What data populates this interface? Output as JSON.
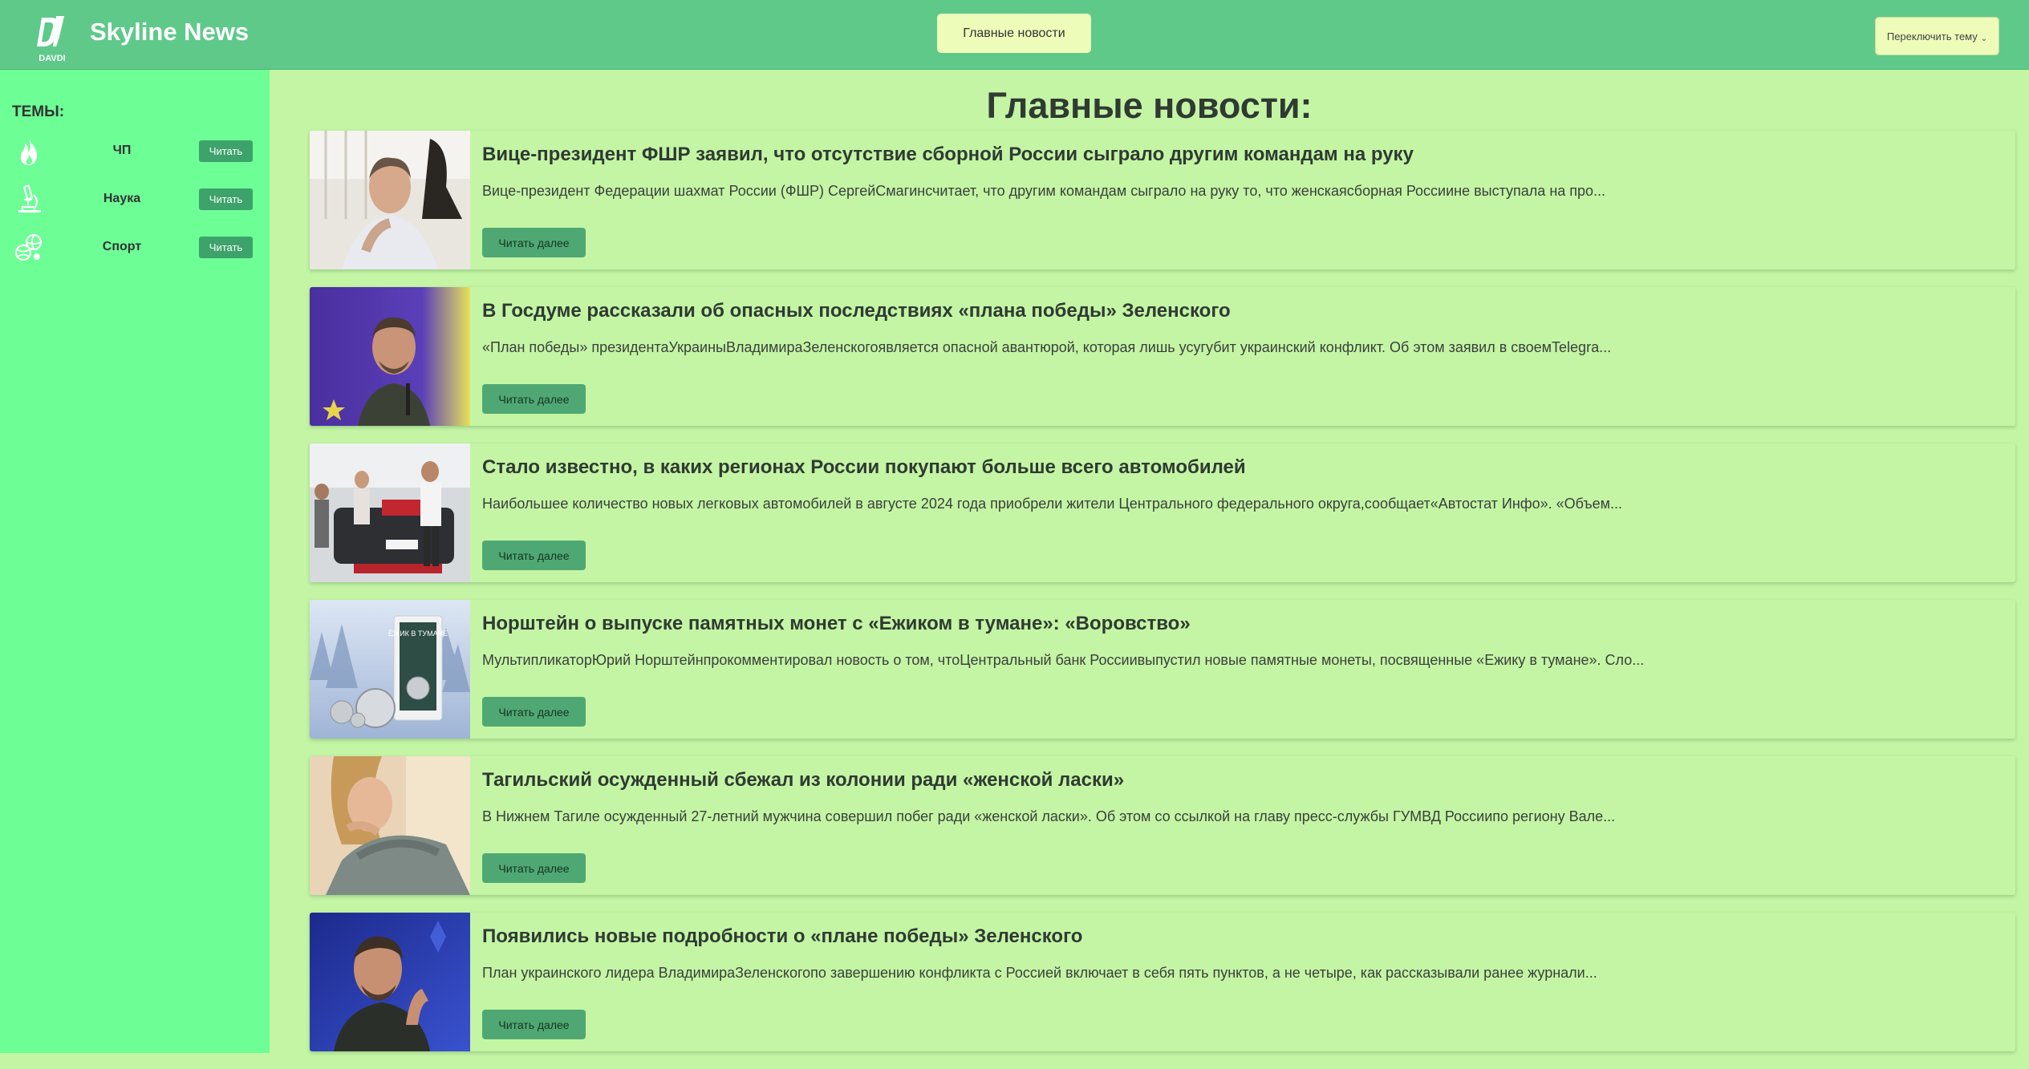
{
  "header": {
    "logo_text": "DAVDI",
    "site_title": "Skyline News",
    "main_news_button": "Главные новости",
    "theme_switch_button": "Переключить тему",
    "theme_switch_chevron": "⌄"
  },
  "sidebar": {
    "heading": "ТЕМЫ:",
    "topics": [
      {
        "label": "ЧП",
        "button": "Читать",
        "icon": "fire-icon"
      },
      {
        "label": "Наука",
        "button": "Читать",
        "icon": "microscope-icon"
      },
      {
        "label": "Спорт",
        "button": "Читать",
        "icon": "sports-balls-icon"
      }
    ]
  },
  "main": {
    "page_title": "Главные новости:",
    "news": [
      {
        "title": "Вице-президент ФШР заявил, что отсутствие сборной России сыграло другим командам на руку",
        "description": "Вице-президент Федерации шахмат России (ФШР) СергейСмагинсчитает, что другим командам сыграло на руку то, что женскаясборная Россиине выступала на про...",
        "button": "Читать далее"
      },
      {
        "title": "В Госдуме рассказали об опасных последствиях «плана победы» Зеленского",
        "description": "«План победы» президентаУкраиныВладимираЗеленскогоявляется опасной авантюрой, которая лишь усугубит украинский конфликт. Об этом заявил в своемTelegra...",
        "button": "Читать далее"
      },
      {
        "title": "Стало известно, в каких регионах России покупают больше всего автомобилей",
        "description": "Наибольшее количество новых легковых автомобилей в августе 2024 года приобрели жители Центрального федерального округа,сообщает«Автостат Инфо». «Объем...",
        "button": "Читать далее"
      },
      {
        "title": "Норштейн о выпуске памятных монет с «Ежиком в тумане»: «Воровство»",
        "description": "МультипликаторЮрий Норштейнпрокомментировал новость о том, чтоЦентральный банк Россиивыпустил новые памятные монеты, посвященные «Ежику в тумане». Сло...",
        "button": "Читать далее",
        "image_text": "ЁЖИК В ТУМАНЕ"
      },
      {
        "title": "Тагильский осужденный сбежал из колонии ради «женской ласки»",
        "description": "В Нижнем Тагиле осужденный 27-летний мужчина совершил побег ради «женской ласки». Об этом со ссылкой на главу пресс-службы ГУМВД Россиипо региону Вале...",
        "button": "Читать далее"
      },
      {
        "title": "Появились новые подробности о «плане победы» Зеленского",
        "description": "План украинского лидера ВладимираЗеленскогопо завершению конфликта с Россией включает в себя пять пунктов, а не четыре, как рассказывали ранее журнали...",
        "button": "Читать далее"
      }
    ]
  },
  "colors": {
    "header_bg": "#5fc98a",
    "sidebar_bg": "#6dfe96",
    "content_bg": "#c4f5a4",
    "button_bg": "#4fa873",
    "light_button_bg": "#edfcb9"
  }
}
